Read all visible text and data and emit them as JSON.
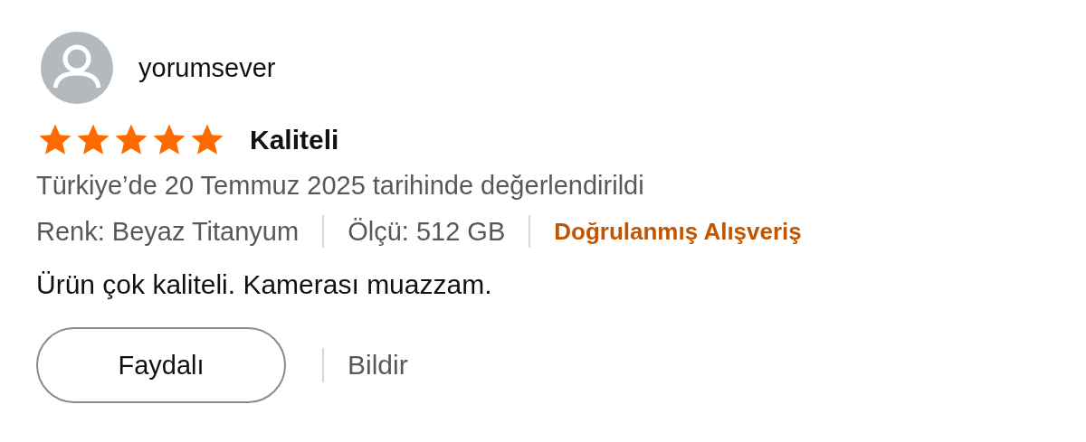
{
  "review": {
    "author": "yorumsever",
    "stars": 5,
    "title": "Kaliteli",
    "date": "Türkiye’de 20 Temmuz 2025 tarihinde değerlendirildi",
    "attributes": [
      "Renk: Beyaz Titanyum",
      "Ölçü: 512 GB"
    ],
    "verified": "Doğrulanmış Alışveriş",
    "body": "Ürün çok kaliteli. Kamerası muazzam.",
    "helpful_button": "Faydalı",
    "report_link": "Bildir"
  }
}
